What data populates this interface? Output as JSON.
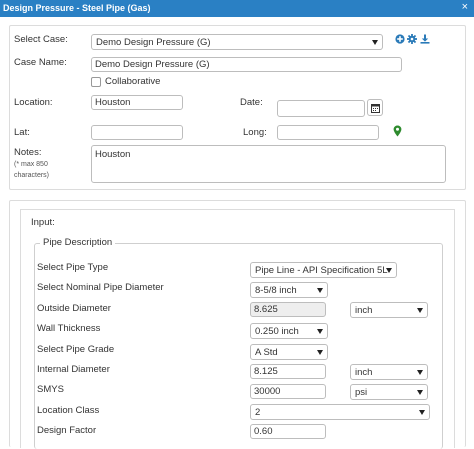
{
  "window": {
    "title": "Design Pressure - Steel Pipe (Gas)",
    "close": "×"
  },
  "form": {
    "select_case_label": "Select Case:",
    "select_case_value": "Demo Design Pressure (G)",
    "case_name_label": "Case Name:",
    "case_name_value": "Demo Design Pressure (G)",
    "collaborative_label": "Collaborative",
    "collaborative_checked": false,
    "location_label": "Location:",
    "location_value": "Houston",
    "date_label": "Date:",
    "date_value": "",
    "lat_label": "Lat:",
    "lat_value": "",
    "long_label": "Long:",
    "long_value": "",
    "notes_label": "Notes:",
    "notes_hint_1": "(* max 850",
    "notes_hint_2": "characters)",
    "notes_value": "Houston"
  },
  "icons": {
    "add": "plus-circle-icon",
    "settings": "gear-icon",
    "download": "download-icon",
    "calendar": "calendar-icon",
    "map_marker": "map-marker-icon"
  },
  "colors": {
    "titlebar": "#2a80c4",
    "action_icons": "#2a7ab8",
    "map_marker": "#2e8b2e"
  },
  "input_section": {
    "label": "Input:",
    "pipe_description": {
      "legend": "Pipe Description",
      "pipe_type_label": "Select Pipe Type",
      "pipe_type_value": "Pipe Line - API Specification 5L",
      "nominal_diameter_label": "Select Nominal Pipe Diameter",
      "nominal_diameter_value": "8-5/8 inch",
      "outside_diameter_label": "Outside Diameter",
      "outside_diameter_value": "8.625",
      "outside_diameter_unit": "inch",
      "wall_thickness_label": "Wall Thickness",
      "wall_thickness_value": "0.250 inch",
      "pipe_grade_label": "Select Pipe Grade",
      "pipe_grade_value": "A Std",
      "internal_diameter_label": "Internal Diameter",
      "internal_diameter_value": "8.125",
      "internal_diameter_unit": "inch",
      "smys_label": "SMYS",
      "smys_value": "30000",
      "smys_unit": "psi",
      "location_class_label": "Location Class",
      "location_class_value": "2",
      "design_factor_label": "Design Factor",
      "design_factor_value": "0.60"
    }
  }
}
